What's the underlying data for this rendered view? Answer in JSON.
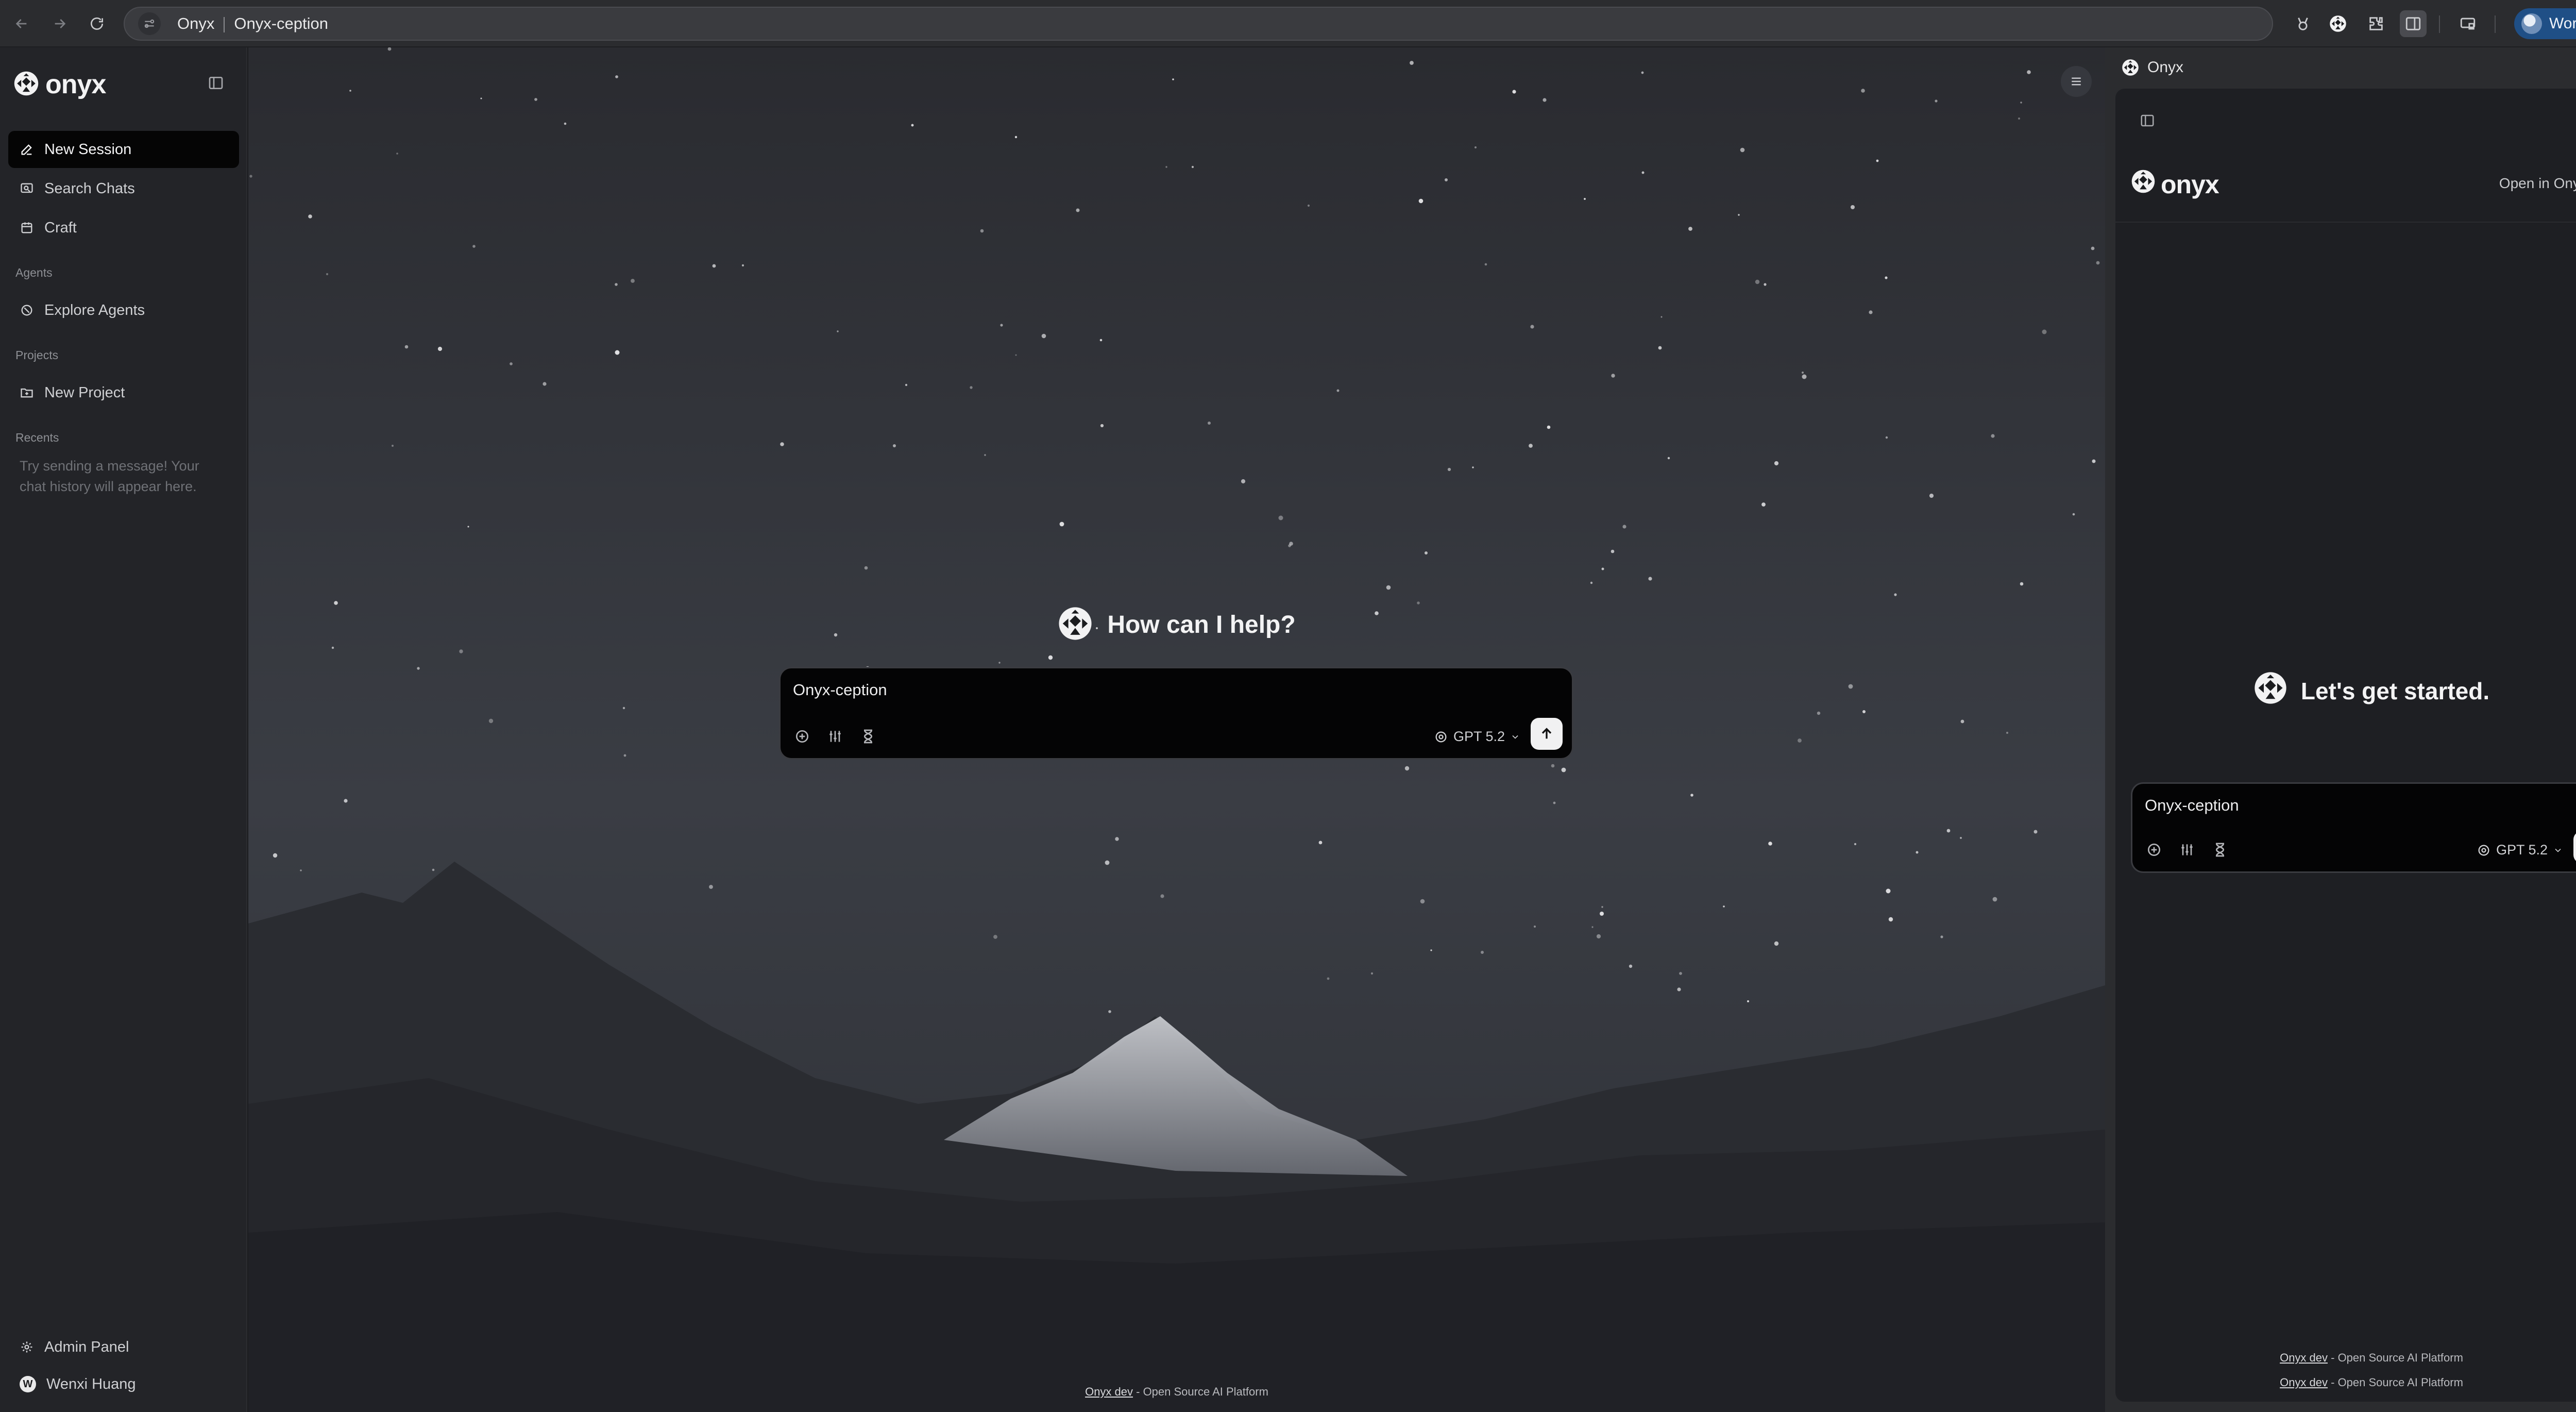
{
  "browser": {
    "tab_site": "Onyx",
    "tab_page": "Onyx-ception",
    "profile_label": "Work"
  },
  "sidebar": {
    "brand": "onyx",
    "items": [
      {
        "label": "New Session",
        "icon": "edit-icon",
        "active": true
      },
      {
        "label": "Search Chats",
        "icon": "search-chats-icon"
      },
      {
        "label": "Craft",
        "icon": "craft-icon"
      }
    ],
    "sections": {
      "agents": {
        "title": "Agents",
        "items": [
          {
            "label": "Explore Agents",
            "icon": "explore-icon"
          }
        ]
      },
      "projects": {
        "title": "Projects",
        "items": [
          {
            "label": "New Project",
            "icon": "folder-plus-icon"
          }
        ]
      },
      "recents": {
        "title": "Recents",
        "empty": "Try sending a message! Your chat history will appear here."
      }
    },
    "bottom": [
      {
        "label": "Admin Panel",
        "icon": "gear-icon"
      },
      {
        "label": "Wenxi Huang",
        "avatar_letter": "W"
      }
    ]
  },
  "main": {
    "hero_title": "How can I help?",
    "composer_value": "Onyx-ception",
    "model": "GPT 5.2",
    "footer_link": "Onyx dev",
    "footer_text": " - Open Source AI Platform"
  },
  "panel": {
    "title": "Onyx",
    "brand": "onyx",
    "open_in": "Open in Onyx",
    "hero_title": "Let's get started.",
    "composer_value": "Onyx-ception",
    "model": "GPT 5.2",
    "footer_link": "Onyx dev",
    "footer_text": " - Open Source AI Platform"
  },
  "colors": {
    "sidebar_bg": "#232428",
    "active_item": "#050505",
    "composer_bg": "#040405",
    "profile_chip": "#1f4f86"
  }
}
